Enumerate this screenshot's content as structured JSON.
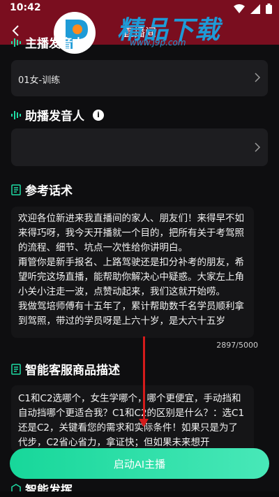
{
  "status_bar": {
    "time": "10:42"
  },
  "app_bar": {
    "title": "直播间"
  },
  "watermark": {
    "title": "精品下载",
    "url": "www.j9p.com"
  },
  "sections": {
    "host_voice": {
      "label": "主播发音人",
      "value": "01女-训练"
    },
    "assistant_voice": {
      "label": "助播发音人",
      "value": ""
    },
    "script": {
      "label": "参考话术",
      "paragraphs": [
        "欢迎各位新进来我直播间的家人、朋友们！来得早不如来得巧呀，我今天开播就一个目的，把所有关于考驾照的流程、细节、坑点一次性给你讲明白。",
        "甭管你是新手报名、上路驾驶还是扣分补考的朋友，希望听完这场直播，能帮助你解决心中疑惑。大家左上角小关小注走一波，点赞动起来，我们这就开始唠。",
        "我做驾培师傅有十五年了，累计帮助数千名学员顺利拿到驾照，带过的学员呀是上六十岁，是大六十五岁"
      ],
      "counter": "2897/5000"
    },
    "product": {
      "label": "智能客服商品描述",
      "paragraphs": [
        "C1和C2选哪个，女生学哪个，哪个更便宜，手动挡和自动挡哪个更适合我？C1和C2的区别是什么？：选C1还是C2，关键看您的需求和实际条件！如果只是为了代步，C2省心省力，拿证快；但如果未来想开"
      ]
    },
    "smart": {
      "label": "智能发挥"
    }
  },
  "start_button": {
    "label": "启动AI主播"
  },
  "colors": {
    "header": "#7a0e1f",
    "accent": "#1fdca4",
    "arrow": "#d41b1b"
  }
}
